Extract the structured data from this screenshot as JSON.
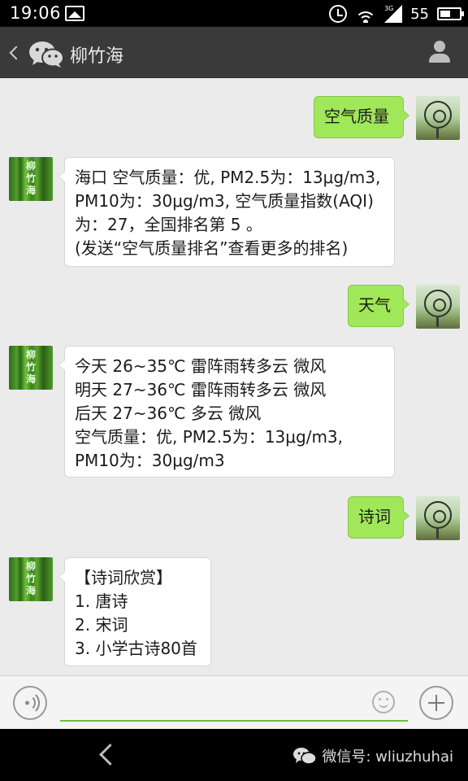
{
  "status_bar": {
    "time": "19:06",
    "network": "3G",
    "battery": "55"
  },
  "header": {
    "title": "柳竹海"
  },
  "contact_avatar_text": "柳竹海",
  "messages": [
    {
      "side": "right",
      "lines": [
        "空气质量"
      ]
    },
    {
      "side": "left",
      "lines": [
        "海口 空气质量：优, PM2.5为：13μg/m3,",
        "PM10为：30μg/m3, 空气质量指数(AQI)",
        "为：27，全国排名第 5 。",
        "(发送“空气质量排名”查看更多的排名)"
      ]
    },
    {
      "side": "right",
      "lines": [
        "天气"
      ]
    },
    {
      "side": "left",
      "lines": [
        "今天 26~35℃ 雷阵雨转多云 微风",
        "明天 27~36℃ 雷阵雨转多云 微风",
        "后天 27~36℃ 多云 微风",
        "空气质量：优, PM2.5为：13μg/m3,",
        "PM10为：30μg/m3"
      ]
    },
    {
      "side": "right",
      "lines": [
        "诗词"
      ]
    },
    {
      "side": "left",
      "lines": [
        "【诗词欣赏】",
        "1. 唐诗",
        "2. 宋词",
        "3. 小学古诗80首"
      ]
    }
  ],
  "input": {
    "value": "",
    "placeholder": ""
  },
  "watermark": {
    "text": "微信号: wliuzhuhai"
  },
  "colors": {
    "header_bg": "#3a3a3a",
    "bubble_sent": "#a0e75a",
    "bubble_received": "#ffffff",
    "chat_bg": "#ebebeb",
    "input_underline": "#6bbf3b"
  }
}
